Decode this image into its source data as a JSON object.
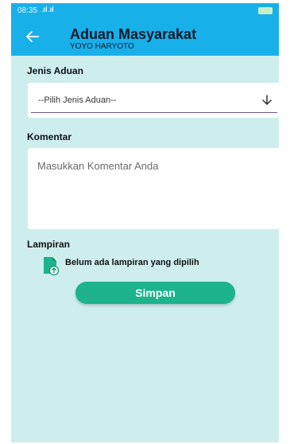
{
  "status_bar": {
    "time": "08:35",
    "signal": ".ııl .ııl",
    "right_icons": "⚡"
  },
  "app_bar": {
    "back_icon": "arrow-left-icon",
    "title": "Aduan Masyarakat",
    "subtitle": "YOYO HARYOTO"
  },
  "form": {
    "jenis_label": "Jenis Aduan",
    "jenis_select_value": "--Pilih Jenis Aduan--",
    "komentar_label": "Komentar",
    "komentar_placeholder": "Masukkan Komentar Anda",
    "lampiran_label": "Lampiran",
    "lampiran_status": "Belum ada lampiran yang dipilih",
    "save_label": "Simpan"
  },
  "colors": {
    "app_bar": "#18b0e9",
    "background": "#cdeeed",
    "save_button": "#1db38c",
    "select_underline": "#6a5a8a"
  }
}
